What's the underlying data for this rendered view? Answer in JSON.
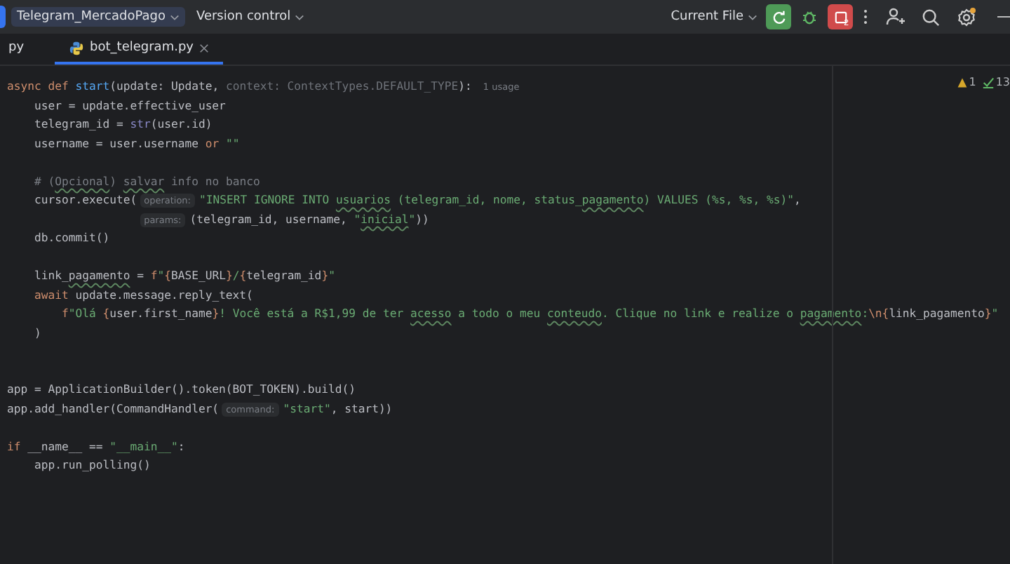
{
  "title_bar": {
    "project": "Telegram_MercadoPago",
    "vcs": "Version control",
    "run_config": "Current File",
    "stop_badge": "2"
  },
  "tabs": [
    {
      "label": "py",
      "selected": false,
      "closable": false
    },
    {
      "label": "bot_telegram.py",
      "selected": true,
      "closable": true
    }
  ],
  "inspections": {
    "warnings": "1",
    "passed": "13"
  },
  "code_lines": [
    {
      "kind": "code",
      "tokens": [
        {
          "kind": "keyword",
          "text": "async def "
        },
        {
          "kind": "funcdef",
          "text": "start"
        },
        {
          "kind": "plain",
          "text": "(update: Update, "
        },
        {
          "kind": "unused",
          "text": "context: ContextTypes.DEFAULT_TYPE"
        },
        {
          "kind": "plain",
          "text": "):"
        },
        {
          "kind": "usage",
          "text": "1 usage"
        }
      ]
    },
    {
      "kind": "code",
      "tokens": [
        {
          "kind": "plain",
          "text": "    user = update.effective_user"
        }
      ]
    },
    {
      "kind": "code",
      "tokens": [
        {
          "kind": "plain",
          "text": "    telegram_id = "
        },
        {
          "kind": "builtin",
          "text": "str"
        },
        {
          "kind": "plain",
          "text": "(user.id)"
        }
      ]
    },
    {
      "kind": "code",
      "tokens": [
        {
          "kind": "plain",
          "text": "    username = user.username "
        },
        {
          "kind": "keyword",
          "text": "or"
        },
        {
          "kind": "string",
          "text": " \"\""
        }
      ]
    },
    {
      "kind": "blank"
    },
    {
      "kind": "code",
      "tokens": [
        {
          "kind": "comment",
          "text": "    # ("
        },
        {
          "kind": "comment_typo",
          "text": "Opcional"
        },
        {
          "kind": "comment",
          "text": ") "
        },
        {
          "kind": "comment_typo",
          "text": "salvar"
        },
        {
          "kind": "comment",
          "text": " info no banco"
        }
      ]
    },
    {
      "kind": "code",
      "tokens": [
        {
          "kind": "plain",
          "text": "    cursor.execute("
        },
        {
          "kind": "hint",
          "text": "operation:"
        },
        {
          "kind": "string",
          "text": "\"INSERT IGNORE INTO "
        },
        {
          "kind": "string_typo",
          "text": "usuarios"
        },
        {
          "kind": "string",
          "text": " (telegram_id, nome, status_"
        },
        {
          "kind": "string_typo",
          "text": "pagamento"
        },
        {
          "kind": "string",
          "text": ") VALUES (%s, %s, %s)\""
        },
        {
          "kind": "plain",
          "text": ","
        }
      ]
    },
    {
      "kind": "continuation",
      "tokens": [
        {
          "kind": "hint",
          "text": "params:"
        },
        {
          "kind": "plain",
          "text": "(telegram_id, username, "
        },
        {
          "kind": "string",
          "text": "\""
        },
        {
          "kind": "string_typo",
          "text": "inicial"
        },
        {
          "kind": "string",
          "text": "\""
        },
        {
          "kind": "plain",
          "text": "))"
        }
      ]
    },
    {
      "kind": "code",
      "tokens": [
        {
          "kind": "plain",
          "text": "    db.commit()"
        }
      ]
    },
    {
      "kind": "blank"
    },
    {
      "kind": "code",
      "tokens": [
        {
          "kind": "plain",
          "text": "    link_"
        },
        {
          "kind": "plain_typo",
          "text": "pagamento"
        },
        {
          "kind": "plain",
          "text": " = "
        },
        {
          "kind": "keyword",
          "text": "f"
        },
        {
          "kind": "string",
          "text": "\""
        },
        {
          "kind": "keyword",
          "text": "{"
        },
        {
          "kind": "plain",
          "text": "BASE_URL"
        },
        {
          "kind": "keyword",
          "text": "}"
        },
        {
          "kind": "string",
          "text": "/"
        },
        {
          "kind": "keyword",
          "text": "{"
        },
        {
          "kind": "plain",
          "text": "telegram_id"
        },
        {
          "kind": "keyword",
          "text": "}"
        },
        {
          "kind": "string",
          "text": "\""
        }
      ]
    },
    {
      "kind": "code",
      "tokens": [
        {
          "kind": "keyword",
          "text": "    await "
        },
        {
          "kind": "plain",
          "text": "update.message.reply_text("
        }
      ]
    },
    {
      "kind": "code",
      "tokens": [
        {
          "kind": "keyword",
          "text": "        f"
        },
        {
          "kind": "string",
          "text": "\"Olá "
        },
        {
          "kind": "keyword",
          "text": "{"
        },
        {
          "kind": "plain",
          "text": "user.first_name"
        },
        {
          "kind": "keyword",
          "text": "}"
        },
        {
          "kind": "string",
          "text": "! Você está a R$1,99 de ter "
        },
        {
          "kind": "string_typo",
          "text": "acesso"
        },
        {
          "kind": "string",
          "text": " a todo o meu "
        },
        {
          "kind": "string_typo",
          "text": "conteudo"
        },
        {
          "kind": "string",
          "text": ". Clique no link e realize o "
        },
        {
          "kind": "string_typo",
          "text": "pagamento"
        },
        {
          "kind": "string",
          "text": ":"
        },
        {
          "kind": "keyword",
          "text": "\\n{"
        },
        {
          "kind": "plain",
          "text": "link_pagamento"
        },
        {
          "kind": "keyword",
          "text": "}"
        },
        {
          "kind": "string",
          "text": "\""
        }
      ]
    },
    {
      "kind": "code",
      "tokens": [
        {
          "kind": "plain",
          "text": "    )"
        }
      ]
    },
    {
      "kind": "blank"
    },
    {
      "kind": "blank"
    },
    {
      "kind": "code",
      "tokens": [
        {
          "kind": "plain",
          "text": "app = ApplicationBuilder().token(BOT_TOKEN).build()"
        }
      ]
    },
    {
      "kind": "code",
      "tokens": [
        {
          "kind": "plain",
          "text": "app.add_handler(CommandHandler("
        },
        {
          "kind": "hint",
          "text": "command:"
        },
        {
          "kind": "string",
          "text": "\"start\""
        },
        {
          "kind": "plain",
          "text": ", start))"
        }
      ]
    },
    {
      "kind": "blank"
    },
    {
      "kind": "code",
      "tokens": [
        {
          "kind": "keyword",
          "text": "if "
        },
        {
          "kind": "plain",
          "text": "__name__ == "
        },
        {
          "kind": "string",
          "text": "\"__main__\""
        },
        {
          "kind": "plain",
          "text": ":"
        }
      ]
    },
    {
      "kind": "code",
      "tokens": [
        {
          "kind": "plain",
          "text": "    app.run_polling()"
        }
      ]
    }
  ]
}
